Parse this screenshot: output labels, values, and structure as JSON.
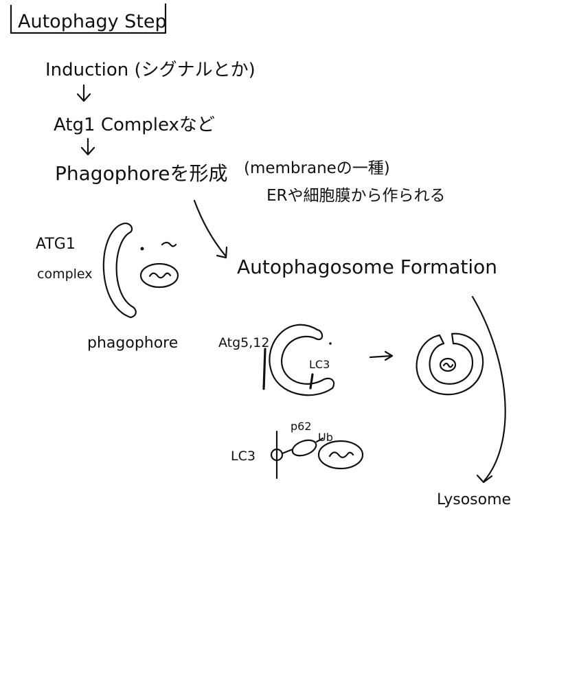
{
  "title": "Autophagy Step",
  "steps": {
    "induction": "Induction (シグナルとか)",
    "atg_complex": "Atg1 Complexなど",
    "phagophore_form": "Phagophoreを形成",
    "membrane_note_1": "(membraneの一種)",
    "membrane_note_2": "ERや細胞膜から作られる"
  },
  "left_figure": {
    "atg1_label": "ATG1",
    "complex_label": "complex",
    "phagophore_label": "phagophore"
  },
  "formation": {
    "heading": "Autophagosome Formation",
    "atg5_12_label": "Atg5,12",
    "lc3_label": "LC3",
    "lc3_row_label": "LC3",
    "p62_label": "p62",
    "ub_label": "Ub",
    "lysosome_label": "Lysosome"
  }
}
